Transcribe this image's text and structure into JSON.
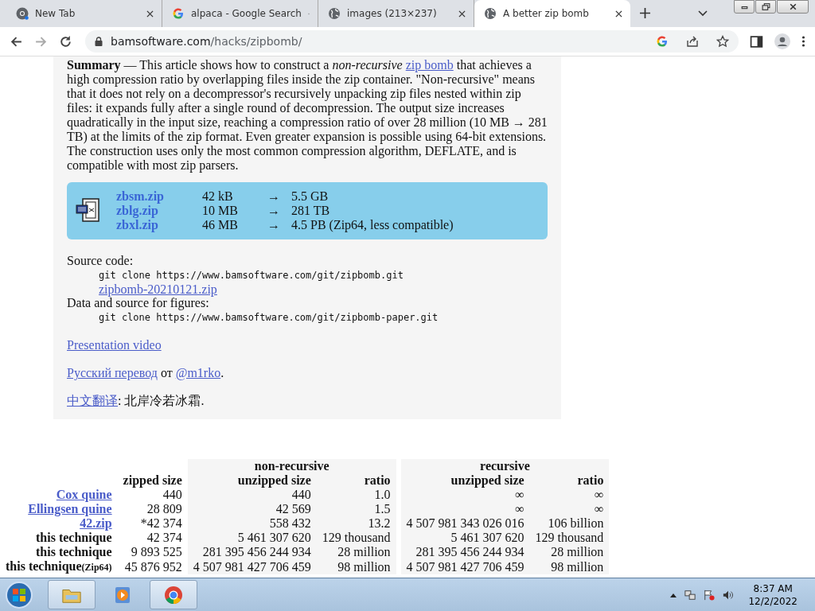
{
  "browser": {
    "tabs": [
      {
        "title": "New Tab",
        "kind": "chrome",
        "selected": false
      },
      {
        "title": "alpaca - Google Search",
        "kind": "google",
        "selected": false
      },
      {
        "title": "images (213×237)",
        "kind": "globe",
        "selected": false
      },
      {
        "title": "A better zip bomb",
        "kind": "globe",
        "selected": true
      }
    ],
    "address": {
      "host": "bamsoftware.com",
      "path": "/hacks/zipbomb/"
    }
  },
  "article": {
    "summary": [
      {
        "kind": "text",
        "text": "**Summary** — This article shows how to construct a *non-recursive* "
      },
      {
        "kind": "link",
        "text": "zip bomb"
      },
      {
        "kind": "text",
        "text": " that achieves a high compression ratio by overlapping files inside the zip container. \"Non-recursive\" means that it does not rely on a decompressor's recursively unpacking zip files nested within zip files: it expands fully after a single round of decompression. The output size increases quadratically in the input size, reaching a compression ratio of over 28 million (10 MB → 281 TB) at the limits of the zip format. Even greater expansion is possible using 64-bit extensions. The construction uses only the most common compression algorithm, DEFLATE, and is compatible with most zip parsers."
      }
    ],
    "downloads": [
      {
        "file": "zbsm.zip",
        "zipped": "42 kB",
        "arrow": "→",
        "unzipped": "5.5 GB"
      },
      {
        "file": "zblg.zip",
        "zipped": "10 MB",
        "arrow": "→",
        "unzipped": "281 TB"
      },
      {
        "file": "zbxl.zip",
        "zipped": "46 MB",
        "arrow": "→",
        "unzipped": "4.5 PB (Zip64, less compatible)"
      }
    ],
    "source": [
      {
        "kind": "label",
        "text": "Source code:"
      },
      {
        "kind": "code",
        "text": "git clone https://www.bamsoftware.com/git/zipbomb.git"
      },
      {
        "kind": "link",
        "text": "zipbomb-20210121.zip"
      },
      {
        "kind": "label",
        "text": "Data and source for figures:"
      },
      {
        "kind": "code",
        "text": "git clone https://www.bamsoftware.com/git/zipbomb-paper.git"
      }
    ],
    "paragraphs": [
      [
        {
          "kind": "link",
          "text": "Presentation video"
        }
      ],
      [
        {
          "kind": "link",
          "text": "Русский перевод"
        },
        {
          "kind": "text",
          "text": " от "
        },
        {
          "kind": "link",
          "text": "@m1rko"
        },
        {
          "kind": "text",
          "text": "."
        }
      ],
      [
        {
          "kind": "link",
          "text": "中文翻译"
        },
        {
          "kind": "text",
          "text": ": 北岸冷若冰霜."
        }
      ]
    ]
  },
  "table": {
    "groups": [
      "non-recursive",
      "recursive"
    ],
    "columns": [
      "zipped size",
      "unzipped size",
      "ratio",
      "unzipped size",
      "ratio"
    ],
    "rows": [
      {
        "name": "Cox quine",
        "link": true,
        "cells": [
          "440",
          "440",
          "1.0",
          "∞",
          "∞"
        ]
      },
      {
        "name": "Ellingsen quine",
        "link": true,
        "cells": [
          "28 809",
          "42 569",
          "1.5",
          "∞",
          "∞"
        ]
      },
      {
        "name": "42.zip",
        "link": true,
        "cells": [
          "*42 374",
          "558 432",
          "13.2",
          "4 507 981 343 026 016",
          "106 billion"
        ]
      },
      {
        "name": "this technique",
        "link": false,
        "cells": [
          "42 374",
          "5 461 307 620",
          "129 thousand",
          "5 461 307 620",
          "129 thousand"
        ]
      },
      {
        "name": "this technique",
        "link": false,
        "cells": [
          "9 893 525",
          "281 395 456 244 934",
          "28 million",
          "281 395 456 244 934",
          "28 million"
        ]
      },
      {
        "name": "this technique",
        "note": "(Zip64)",
        "link": false,
        "cells": [
          "45 876 952",
          "4 507 981 427 706 459",
          "98 million",
          "4 507 981 427 706 459",
          "98 million"
        ]
      }
    ]
  },
  "taskbar": {
    "apps": [
      {
        "kind": "explorer"
      },
      {
        "kind": "media"
      },
      {
        "kind": "chrome"
      }
    ],
    "time": "8:37 AM",
    "date": "12/2/2022"
  }
}
